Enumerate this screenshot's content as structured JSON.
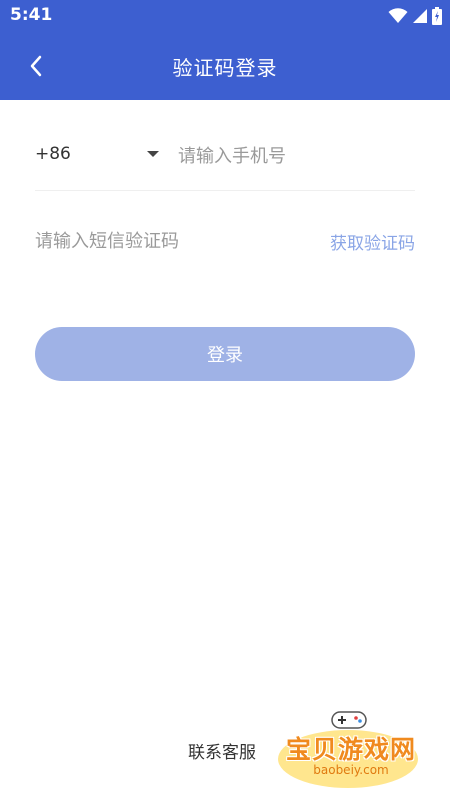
{
  "status_bar": {
    "time": "5:41",
    "icons": [
      "wifi-icon",
      "signal-icon",
      "battery-icon"
    ]
  },
  "header": {
    "title": "验证码登录",
    "back_icon": "chevron-left-icon"
  },
  "form": {
    "country_code": "+86",
    "phone_placeholder": "请输入手机号",
    "code_placeholder": "请输入短信验证码",
    "get_code_label": "获取验证码",
    "login_label": "登录"
  },
  "footer": {
    "contact_label": "联系客服"
  },
  "watermark": {
    "text": "宝贝游戏网",
    "url": "baobeiy.com"
  },
  "colors": {
    "header_bg": "#3d5fd0",
    "login_button_bg": "#9fb2e6",
    "link": "#8aa5e6"
  }
}
